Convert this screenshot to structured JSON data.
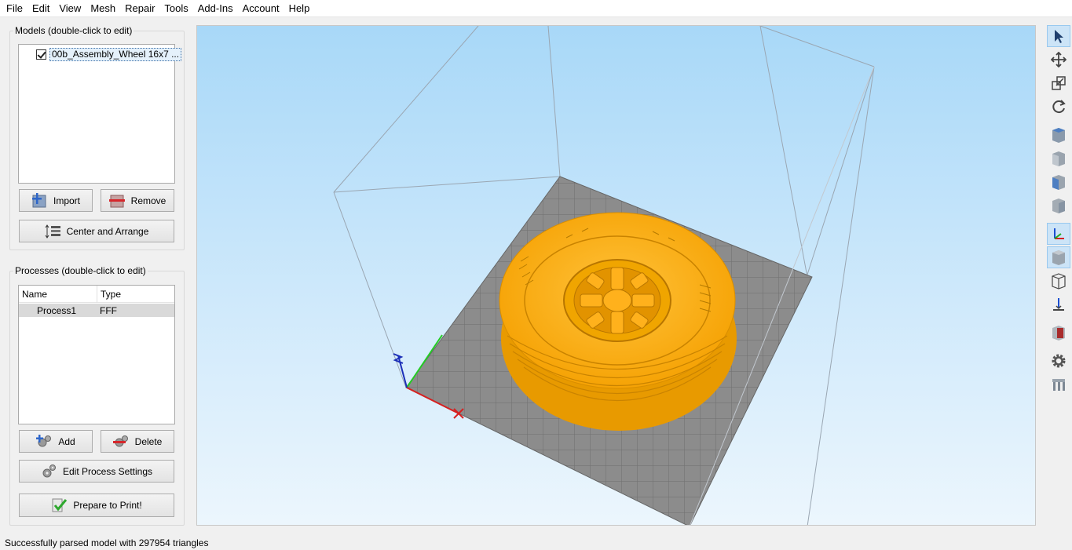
{
  "menu": [
    "File",
    "Edit",
    "View",
    "Mesh",
    "Repair",
    "Tools",
    "Add-Ins",
    "Account",
    "Help"
  ],
  "models": {
    "title": "Models (double-click to edit)",
    "items": [
      {
        "label": "00b_Assembly_Wheel 16x7 ...",
        "checked": true
      }
    ],
    "import_label": "Import",
    "remove_label": "Remove",
    "center_label": "Center and Arrange"
  },
  "processes": {
    "title": "Processes (double-click to edit)",
    "columns": [
      "Name",
      "Type"
    ],
    "rows": [
      {
        "name": "Process1",
        "type": "FFF"
      }
    ],
    "add_label": "Add",
    "delete_label": "Delete",
    "edit_label": "Edit Process Settings",
    "prepare_label": "Prepare to Print!"
  },
  "toolbar": {
    "icons": [
      "select-icon",
      "move-icon",
      "scale-icon",
      "rotate-icon",
      "view-front-icon",
      "view-back-icon",
      "view-left-icon",
      "view-right-icon",
      "axes-icon",
      "solid-view-icon",
      "wireframe-icon",
      "section-icon",
      "cross-section-icon",
      "settings-icon",
      "supports-icon"
    ]
  },
  "status": {
    "message": "Successfully parsed model with 297954 triangles"
  },
  "colors": {
    "model": "#ffae00",
    "bed": "#8c8c8c",
    "sky_top": "#a8d8f8",
    "sky_bottom": "#ecf6fd"
  }
}
